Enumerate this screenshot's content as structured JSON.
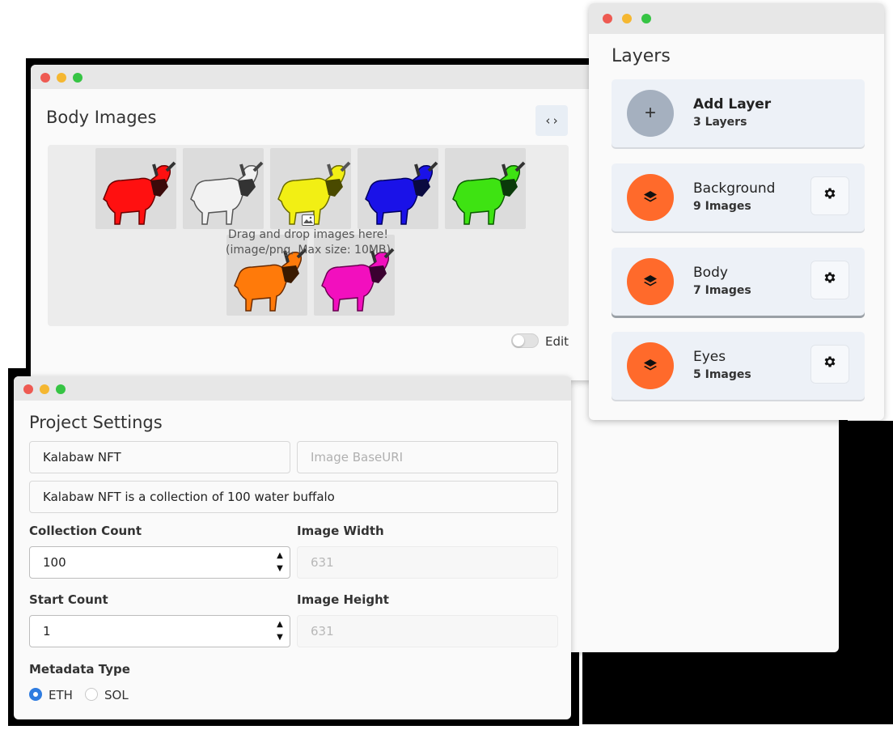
{
  "body_images": {
    "title": "Body Images",
    "code_button_label": "‹›",
    "drop_text_1": "Drag and drop images here!",
    "drop_text_2": "(image/png, Max size: 10MB)",
    "thumbnails": [
      {
        "name": "red buffalo",
        "color": "#ff1010"
      },
      {
        "name": "white buffalo",
        "color": "#f2f2f2"
      },
      {
        "name": "yellow buffalo",
        "color": "#f2ef14"
      },
      {
        "name": "blue buffalo",
        "color": "#1a12e8"
      },
      {
        "name": "green buffalo",
        "color": "#3ee312"
      },
      {
        "name": "orange buffalo",
        "color": "#ff7a0a"
      },
      {
        "name": "pink buffalo",
        "color": "#f20fbe"
      }
    ],
    "edit_label": "Edit",
    "edit_enabled": false
  },
  "layers": {
    "title": "Layers",
    "add_layer": {
      "label": "Add Layer",
      "count": "3 Layers",
      "icon": "plus-icon"
    },
    "items": [
      {
        "name": "Background",
        "count": "9 Images",
        "icon": "layers-icon",
        "settings_icon": "gear-icon"
      },
      {
        "name": "Body",
        "count": "7 Images",
        "icon": "layers-icon",
        "settings_icon": "gear-icon",
        "selected": true
      },
      {
        "name": "Eyes",
        "count": "5 Images",
        "icon": "layers-icon",
        "settings_icon": "gear-icon"
      }
    ]
  },
  "project_settings": {
    "title": "Project Settings",
    "project_name": "Kalabaw NFT",
    "base_uri_placeholder": "Image BaseURI",
    "description": "Kalabaw NFT is a collection of 100 water buffalo",
    "collection_count_label": "Collection Count",
    "collection_count": "100",
    "image_width_label": "Image Width",
    "image_width": "631",
    "start_count_label": "Start Count",
    "start_count": "1",
    "image_height_label": "Image Height",
    "image_height": "631",
    "metadata_type_label": "Metadata Type",
    "metadata_options": [
      "ETH",
      "SOL"
    ],
    "metadata_selected": "ETH"
  },
  "colors": {
    "accent_orange": "#ff6a2b",
    "radio_blue": "#2f7ce0",
    "titlebar": "#e7e7e7"
  }
}
